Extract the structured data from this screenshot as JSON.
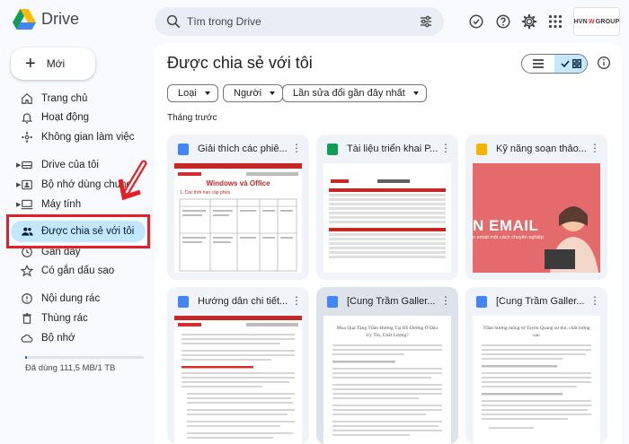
{
  "app": {
    "name": "Drive"
  },
  "search": {
    "placeholder": "Tìm trong Drive"
  },
  "account": {
    "label_pre": "HVN",
    "label_mark": "W",
    "label_post": "GROUP"
  },
  "new_button": {
    "plus": "+",
    "label": "Mới"
  },
  "sidebar": {
    "items": [
      {
        "label": "Trang chủ",
        "icon": "home-icon"
      },
      {
        "label": "Hoạt động",
        "icon": "bell-icon"
      },
      {
        "label": "Không gian làm việc",
        "icon": "workspace-icon"
      },
      {
        "label": "Drive của tôi",
        "icon": "drive-icon"
      },
      {
        "label": "Bộ nhớ dùng chung",
        "icon": "shared-drive-icon"
      },
      {
        "label": "Máy tính",
        "icon": "computer-icon"
      },
      {
        "label": "Được chia sẻ với tôi",
        "icon": "people-icon",
        "active": true
      },
      {
        "label": "Gần đây",
        "icon": "clock-icon"
      },
      {
        "label": "Có gắn dấu sao",
        "icon": "star-icon"
      },
      {
        "label": "Nội dung rác",
        "icon": "spam-icon"
      },
      {
        "label": "Thùng rác",
        "icon": "trash-icon"
      },
      {
        "label": "Bộ nhớ",
        "icon": "cloud-icon"
      }
    ],
    "storage": {
      "text": "Đã dùng 111,5 MB/1 TB",
      "used_fraction": 0.01
    }
  },
  "main": {
    "title": "Được chia sẻ với tôi",
    "filters": [
      "Loại",
      "Người",
      "Lần sửa đổi gần đây nhất"
    ],
    "section": "Tháng trước",
    "files": [
      {
        "title": "Giải thích các phiê...",
        "type": "doc",
        "thumb_heading": "Windows và Office",
        "thumb_sub": "1. Các thời hạn cấp phép"
      },
      {
        "title": "Tài liệu triển khai P...",
        "type": "sheet"
      },
      {
        "title": "Kỹ năng soạn thảo...",
        "type": "slide",
        "thumb_text": "N EMAIL",
        "thumb_sub": "n email một cách chuyên nghiệp"
      },
      {
        "title": "Hướng dẫn chi tiết...",
        "type": "doc"
      },
      {
        "title": "[Cung Trầm Galler...",
        "type": "doc",
        "thumb_heading": "Mua Quà Tặng Trầm Hương Tại Hồ Đường Ở Đâu Uy Tín, Chất Lượng?"
      },
      {
        "title": "[Cung Trầm Galler...",
        "type": "doc",
        "thumb_heading": "Trầm hương mộng từ Tuyên Quang sự thu, chất lượng sao"
      }
    ]
  },
  "colors": {
    "accent": "#0b57d0",
    "active_bg": "#c2e7ff",
    "annotation_red": "#e41f25",
    "doc_blue": "#4285f4",
    "sheet_green": "#0f9d58",
    "slide_yellow": "#f4b400"
  }
}
